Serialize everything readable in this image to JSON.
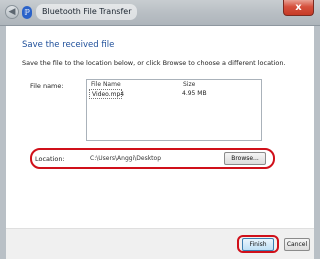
{
  "window": {
    "title": "Bluetooth File Transfer",
    "back_icon": "back-arrow-icon",
    "app_icon": "bluetooth-icon",
    "close_label": "x"
  },
  "content": {
    "heading": "Save the received file",
    "instructions": "Save the file to the location below, or click Browse to choose a different location.",
    "file_name_label": "File name:",
    "columns": [
      "File Name",
      "Size"
    ],
    "files": [
      {
        "name": "Video.mp4",
        "size": "4.95 MB"
      }
    ],
    "location_label": "Location:",
    "location_path": "C:\\Users\\Anggi\\Desktop",
    "browse_label": "Browse..."
  },
  "footer": {
    "finish_label": "Finish",
    "cancel_label": "Cancel"
  },
  "colors": {
    "heading": "#1e4f9a",
    "annotation_ring": "#d0101a"
  }
}
